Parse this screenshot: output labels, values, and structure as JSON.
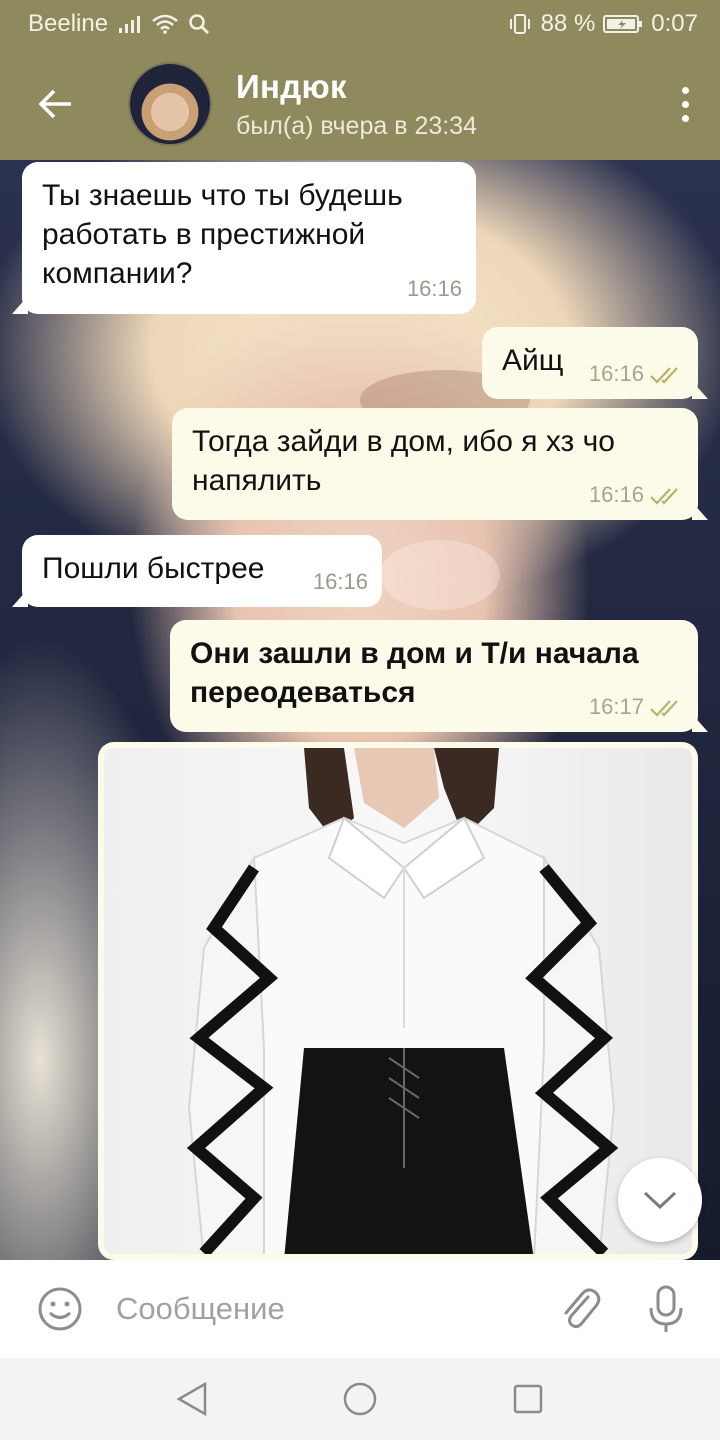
{
  "status_bar": {
    "carrier": "Beeline",
    "battery": "88 %",
    "time": "0:07"
  },
  "header": {
    "name": "Индюк",
    "status": "был(а) вчера в 23:34"
  },
  "messages": [
    {
      "direction": "in",
      "text": "Ты знаешь что ты будешь работать в престижной компании?",
      "time": "16:16"
    },
    {
      "direction": "out",
      "text": "Айщ",
      "time": "16:16",
      "read": true
    },
    {
      "direction": "out",
      "text": "Тогда зайди в дом, ибо я хз чо напялить",
      "time": "16:16",
      "read": true
    },
    {
      "direction": "in",
      "text": "Пошли быстрее",
      "time": "16:16"
    },
    {
      "direction": "out",
      "text": "Они зашли в дом и Т/и начала переодеваться",
      "time": "16:17",
      "read": true,
      "bold": true
    },
    {
      "direction": "out",
      "type": "photo",
      "description_icon": "photo-of-white-shirt-with-black-ribbons"
    }
  ],
  "input": {
    "placeholder": "Сообщение"
  },
  "colors": {
    "header": "#8f8a5e",
    "incoming_bubble": "#ffffff",
    "outgoing_bubble": "#fcfbe9",
    "read_check": "#b7b36a"
  },
  "icons": [
    "back-arrow-icon",
    "more-vert-icon",
    "emoji-icon",
    "attach-icon",
    "mic-icon",
    "chevron-down-icon",
    "nav-back-icon",
    "nav-home-icon",
    "nav-recents-icon"
  ]
}
